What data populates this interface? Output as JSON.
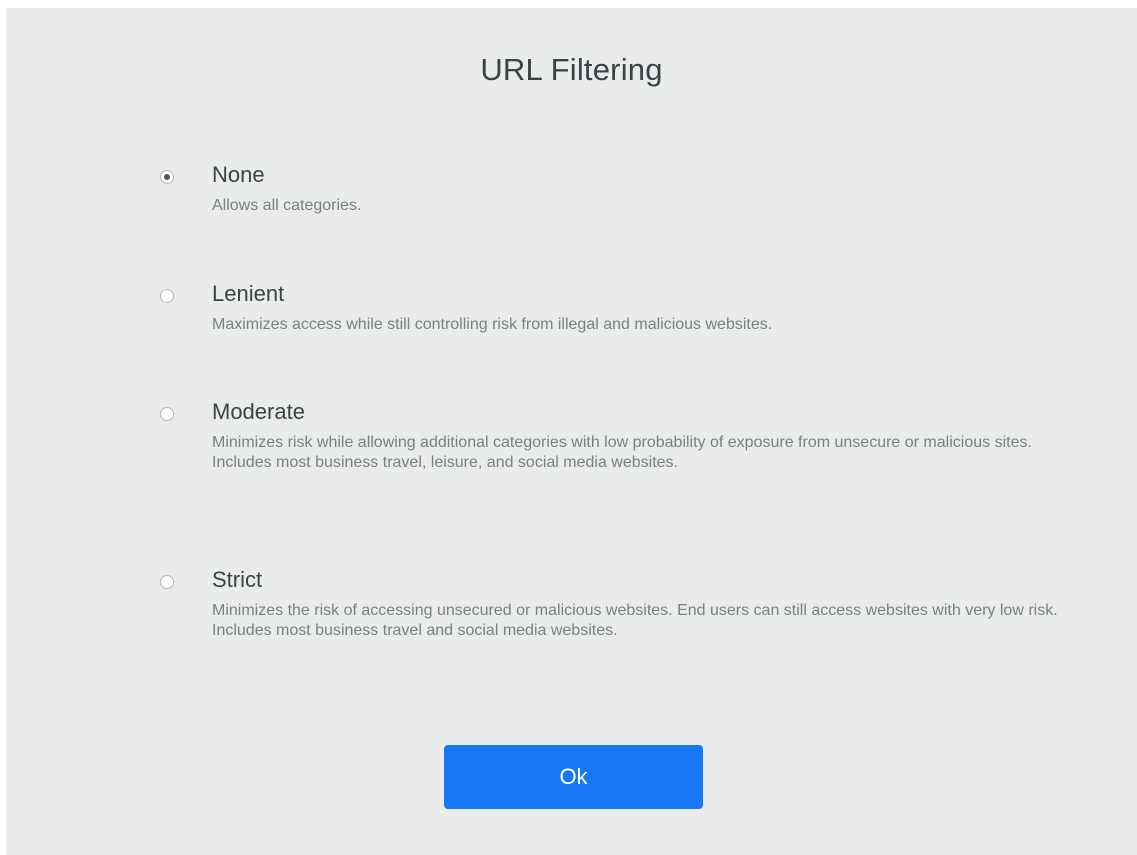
{
  "dialog": {
    "title": "URL Filtering",
    "options": [
      {
        "label": "None",
        "description": "Allows all categories.",
        "selected": true
      },
      {
        "label": "Lenient",
        "description": "Maximizes access while still controlling risk from illegal and malicious websites.",
        "selected": false
      },
      {
        "label": "Moderate",
        "description": "Minimizes risk while allowing additional categories with low probability of exposure from unsecure or malicious sites. Includes most business travel, leisure, and social media websites.",
        "selected": false
      },
      {
        "label": "Strict",
        "description": "Minimizes the risk of accessing unsecured or malicious websites. End users can still access websites with very low risk. Includes most business travel and social media websites.",
        "selected": false
      }
    ],
    "ok_label": "Ok"
  },
  "colors": {
    "background": "#eaebeb",
    "accent": "#1877f2",
    "text": "#3d4246",
    "muted_text": "#7a7f84"
  }
}
